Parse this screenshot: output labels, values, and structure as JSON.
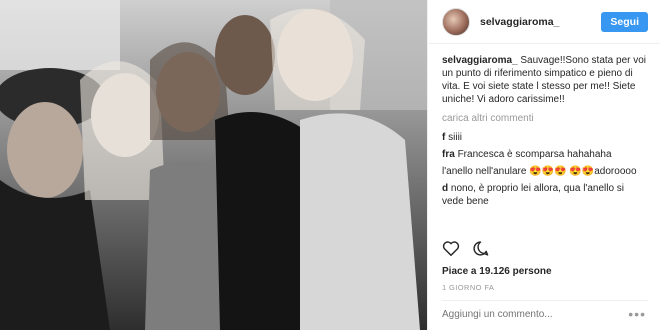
{
  "post": {
    "username": "selvaggiaroma_",
    "follow_label": "Segui",
    "caption_author": "selvaggiaroma_",
    "caption_text": "Sauvage!!Sono stata per voi un punto di riferimento simpatico e pieno di vita. E voi siete state l stesso per me!! Siete uniche! Vi adoro carissime!!",
    "load_more": "carica altri commenti",
    "comments": [
      {
        "author": "f",
        "text": "siiii"
      },
      {
        "author": "fra",
        "text": "Francesca è scomparsa hahahaha"
      },
      {
        "author": "",
        "text": "l'anello nell'anulare 😍😍😍 😍😍adoroooo"
      },
      {
        "author": "d",
        "text": "nono, è proprio lei allora, qua l'anello si vede bene"
      }
    ],
    "likes": "Piace a 19.126 persone",
    "time_ago": "1 GIORNO FA",
    "add_comment_placeholder": "Aggiungi un commento...",
    "more_options": "•••"
  },
  "icons": {
    "like": "heart-icon",
    "comment": "speech-bubble-icon",
    "more": "more-options-icon"
  },
  "colors": {
    "follow_button": "#3897f0",
    "text": "#262626",
    "muted": "#999999"
  }
}
